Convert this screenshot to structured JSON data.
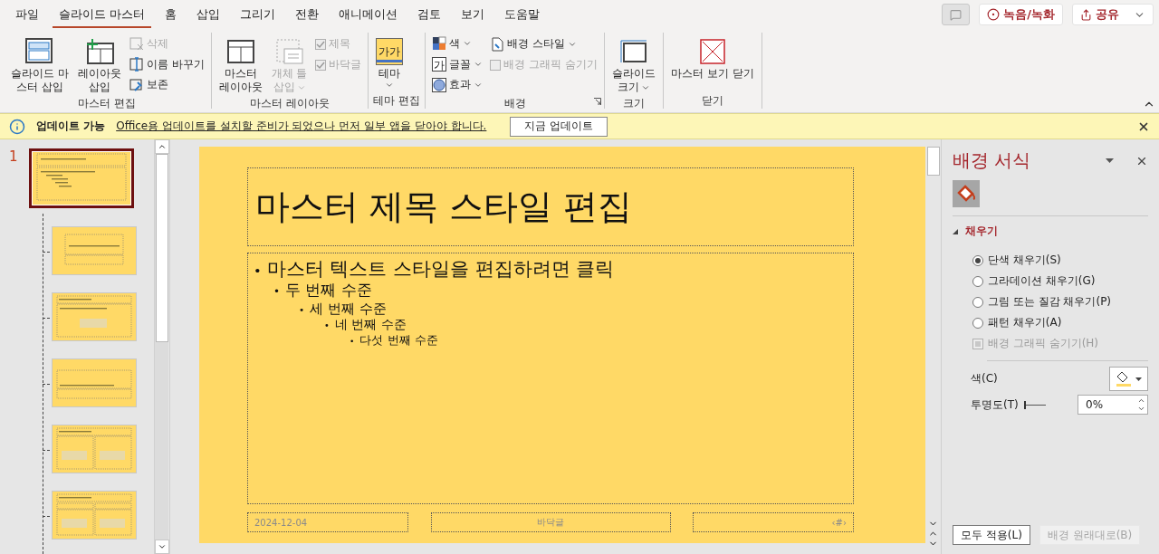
{
  "menu_tabs": [
    {
      "label": "파일",
      "selected": false
    },
    {
      "label": "슬라이드 마스터",
      "selected": true
    },
    {
      "label": "홈",
      "selected": false
    },
    {
      "label": "삽입",
      "selected": false
    },
    {
      "label": "그리기",
      "selected": false
    },
    {
      "label": "전환",
      "selected": false
    },
    {
      "label": "애니메이션",
      "selected": false
    },
    {
      "label": "검토",
      "selected": false
    },
    {
      "label": "보기",
      "selected": false
    },
    {
      "label": "도움말",
      "selected": false
    }
  ],
  "top_buttons": [
    {
      "kind": "comment"
    },
    {
      "kind": "record",
      "label": "녹음/녹화"
    },
    {
      "kind": "share",
      "label": "공유"
    }
  ],
  "ribbon_groups": [
    {
      "label": "마스터 편집",
      "columns": [
        [
          {
            "kind": "large",
            "lines": [
              "슬라이드 마",
              "스터 삽입"
            ],
            "disabled": false
          }
        ],
        [
          {
            "kind": "large",
            "lines": [
              "레이아웃",
              "삽입"
            ],
            "disabled": false
          }
        ],
        [
          {
            "kind": "small",
            "label": "삭제",
            "disabled": true
          },
          {
            "kind": "small",
            "label": "이름 바꾸기",
            "disabled": false
          },
          {
            "kind": "small",
            "label": "보존",
            "disabled": false
          }
        ]
      ]
    },
    {
      "label": "마스터 레이아웃",
      "columns": [
        [
          {
            "kind": "large",
            "lines": [
              "마스터",
              "레이아웃"
            ],
            "disabled": false
          }
        ],
        [
          {
            "kind": "large",
            "lines": [
              "개체 틀",
              "삽입"
            ],
            "disabled": true,
            "dropdown": true
          }
        ],
        [
          {
            "kind": "check",
            "label": "제목",
            "checked": true,
            "disabled": true
          },
          {
            "kind": "check",
            "label": "바닥글",
            "checked": true,
            "disabled": true
          }
        ]
      ]
    },
    {
      "label": "테마 편집",
      "columns": [
        [
          {
            "kind": "large",
            "lines": [
              "테마"
            ],
            "icon_text": "가가",
            "disabled": false,
            "dropdown": true
          }
        ]
      ]
    },
    {
      "label": "배경",
      "launcher": true,
      "columns": [
        [
          {
            "kind": "small",
            "label": "색",
            "disabled": false,
            "dropdown": true
          },
          {
            "kind": "small",
            "label": "글꼴",
            "icon_text": "가",
            "disabled": false,
            "dropdown": true
          },
          {
            "kind": "small",
            "label": "효과",
            "disabled": false,
            "dropdown": true
          }
        ],
        [
          {
            "kind": "small",
            "label": "배경 스타일",
            "disabled": false,
            "dropdown": true
          },
          {
            "kind": "check",
            "label": "배경 그래픽 숨기기",
            "checked": false,
            "disabled": true
          }
        ]
      ]
    },
    {
      "label": "크기",
      "columns": [
        [
          {
            "kind": "large",
            "lines": [
              "슬라이드",
              "크기"
            ],
            "disabled": false,
            "dropdown": true
          }
        ]
      ]
    },
    {
      "label": "닫기",
      "columns": [
        [
          {
            "kind": "large",
            "lines": [
              "마스터 보기 닫기"
            ],
            "disabled": false
          }
        ]
      ]
    }
  ],
  "update_bar": {
    "title": "업데이트 가능",
    "message": "Office용 업데이트를 설치할 준비가 되었으나 먼저 일부 앱을 닫아야 합니다.",
    "button": "지금 업데이트"
  },
  "thumbnails": {
    "number": "1",
    "items": [
      {
        "kind": "master",
        "selected": true
      },
      {
        "kind": "title",
        "selected": false
      },
      {
        "kind": "content",
        "selected": false
      },
      {
        "kind": "section",
        "selected": false
      },
      {
        "kind": "two",
        "selected": false
      },
      {
        "kind": "compare",
        "selected": false
      }
    ]
  },
  "slide": {
    "title": "마스터 제목 스타일 편집",
    "bullets": [
      {
        "marker": "•",
        "text": "마스터 텍스트 스타일을 편집하려면 클릭",
        "children": [
          {
            "marker": "•",
            "text": "두 번째 수준",
            "children": [
              {
                "marker": "•",
                "text": "세 번째 수준",
                "children": [
                  {
                    "marker": "•",
                    "text": "네 번째 수준",
                    "children": [
                      {
                        "marker": "•",
                        "text": "다섯 번째 수준"
                      }
                    ]
                  }
                ]
              }
            ]
          }
        ]
      }
    ],
    "date": "2024-12-04",
    "footer": "바닥글",
    "page_number": "‹#›"
  },
  "format_pane": {
    "title": "배경 서식",
    "section": "채우기",
    "expanded": true,
    "fill_options": [
      {
        "label": "단색 채우기(S)",
        "selected": true
      },
      {
        "label": "그라데이션 채우기(G)",
        "selected": false
      },
      {
        "label": "그림 또는 질감 채우기(P)",
        "selected": false
      },
      {
        "label": "패턴 채우기(A)",
        "selected": false
      }
    ],
    "hide_graphics": {
      "label": "배경 그래픽 숨기기(H)",
      "checked": false,
      "disabled": true
    },
    "color_label": "색(C)",
    "transparency_label": "투명도(T)",
    "transparency": {
      "level": 0,
      "value": "0%"
    },
    "buttons": [
      {
        "label": "모두 적용(L)",
        "disabled": false
      },
      {
        "label": "배경 원래대로(B)",
        "disabled": true
      }
    ]
  }
}
